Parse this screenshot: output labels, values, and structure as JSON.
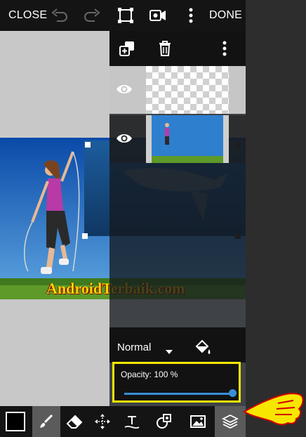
{
  "topbar": {
    "close_label": "CLOSE",
    "done_label": "DONE",
    "icons": [
      "undo-icon",
      "redo-icon",
      "crop-icon",
      "video-icon",
      "more-vert-icon"
    ]
  },
  "panel": {
    "icons": [
      "duplicate-layer-icon",
      "delete-icon",
      "more-vert-icon"
    ],
    "layers": [
      {
        "visible": true,
        "type": "transparent"
      },
      {
        "visible": true,
        "type": "photo"
      }
    ],
    "blend_mode": "Normal",
    "opacity_label": "Opacity: 100 %",
    "opacity_value": 100
  },
  "canvas": {
    "watermark": "AndroidTerbaik.com"
  },
  "bottombar": {
    "tools": [
      "color-swatch",
      "brush-icon",
      "eraser-icon",
      "move-icon",
      "text-icon",
      "shapes-icon",
      "image-icon",
      "layers-icon"
    ]
  },
  "colors": {
    "accent": "#3a8fd6",
    "highlight": "#f4e800",
    "watermark": "#f3d800"
  }
}
